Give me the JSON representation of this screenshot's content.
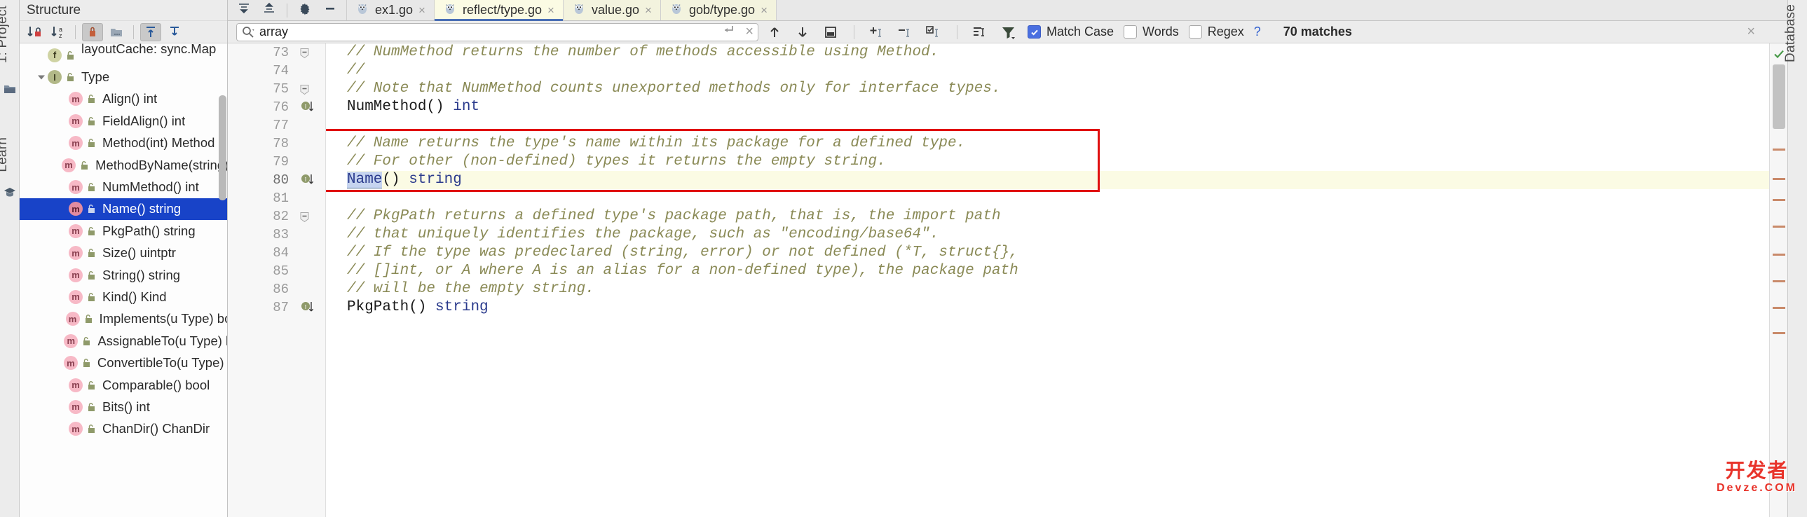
{
  "window": {
    "left_strip": {
      "project_label": "1: Project",
      "learn_label": "Learn",
      "folder_icon": "folder-icon",
      "learn_icon": "graduation-cap-icon"
    },
    "right_strip": {
      "database_label": "Database"
    }
  },
  "sidebar": {
    "title": "Structure",
    "header_actions": [
      {
        "name": "collapse-all-icon",
        "label": "Collapse All"
      },
      {
        "name": "expand-all-icon",
        "label": "Expand All"
      },
      {
        "name": "settings-gear-icon",
        "label": "Settings"
      },
      {
        "name": "hide-icon",
        "label": "Hide"
      }
    ],
    "toolbar": [
      {
        "name": "sort-by-visibility-icon",
        "label": "Sort by Visibility",
        "active": false
      },
      {
        "name": "sort-alphabetically-icon",
        "label": "Sort Alphabetically",
        "active": false
      },
      {
        "name": "show-anonymous-classes-icon",
        "label": "Show Anonymous Classes",
        "active": true
      },
      {
        "name": "group-by-file-icon",
        "label": "Group Methods by Defining Type",
        "active": false
      },
      {
        "name": "expand-all-tree-icon",
        "label": "Expand All",
        "active": true
      },
      {
        "name": "collapse-all-tree-icon",
        "label": "Collapse All",
        "active": false
      }
    ],
    "items": [
      {
        "label": "layoutCache: sync.Map",
        "kind": "field",
        "badge": "f",
        "indent": 1,
        "selected": false,
        "clipped": true,
        "arrow": "none"
      },
      {
        "label": "Type",
        "kind": "interface",
        "badge": "i",
        "indent": 1,
        "selected": false,
        "arrow": "expanded"
      },
      {
        "label": "Align() int",
        "kind": "method",
        "badge": "m",
        "indent": 2,
        "selected": false,
        "arrow": "none"
      },
      {
        "label": "FieldAlign() int",
        "kind": "method",
        "badge": "m",
        "indent": 2,
        "selected": false,
        "arrow": "none"
      },
      {
        "label": "Method(int) Method",
        "kind": "method",
        "badge": "m",
        "indent": 2,
        "selected": false,
        "arrow": "none"
      },
      {
        "label": "MethodByName(string) (Meth",
        "kind": "method",
        "badge": "m",
        "indent": 2,
        "selected": false,
        "arrow": "none"
      },
      {
        "label": "NumMethod() int",
        "kind": "method",
        "badge": "m",
        "indent": 2,
        "selected": false,
        "arrow": "none"
      },
      {
        "label": "Name() string",
        "kind": "method",
        "badge": "m",
        "indent": 2,
        "selected": true,
        "arrow": "none"
      },
      {
        "label": "PkgPath() string",
        "kind": "method",
        "badge": "m",
        "indent": 2,
        "selected": false,
        "arrow": "none"
      },
      {
        "label": "Size() uintptr",
        "kind": "method",
        "badge": "m",
        "indent": 2,
        "selected": false,
        "arrow": "none"
      },
      {
        "label": "String() string",
        "kind": "method",
        "badge": "m",
        "indent": 2,
        "selected": false,
        "arrow": "none"
      },
      {
        "label": "Kind() Kind",
        "kind": "method",
        "badge": "m",
        "indent": 2,
        "selected": false,
        "arrow": "none"
      },
      {
        "label": "Implements(u Type) bool",
        "kind": "method",
        "badge": "m",
        "indent": 2,
        "selected": false,
        "arrow": "none"
      },
      {
        "label": "AssignableTo(u Type) bool",
        "kind": "method",
        "badge": "m",
        "indent": 2,
        "selected": false,
        "arrow": "none"
      },
      {
        "label": "ConvertibleTo(u Type) bool",
        "kind": "method",
        "badge": "m",
        "indent": 2,
        "selected": false,
        "arrow": "none"
      },
      {
        "label": "Comparable() bool",
        "kind": "method",
        "badge": "m",
        "indent": 2,
        "selected": false,
        "arrow": "none"
      },
      {
        "label": "Bits() int",
        "kind": "method",
        "badge": "m",
        "indent": 2,
        "selected": false,
        "arrow": "none"
      },
      {
        "label": "ChanDir() ChanDir",
        "kind": "method",
        "badge": "m",
        "indent": 2,
        "selected": false,
        "arrow": "none"
      }
    ]
  },
  "tabs": [
    {
      "label": "ex1.go",
      "active": false,
      "icon": "go-gopher-icon",
      "close": "×"
    },
    {
      "label": "reflect/type.go",
      "active": true,
      "icon": "go-gopher-icon",
      "close": "×"
    },
    {
      "label": "value.go",
      "active": false,
      "icon": "go-gopher-icon",
      "close": "×"
    },
    {
      "label": "gob/type.go",
      "active": false,
      "icon": "go-gopher-icon",
      "close": "×"
    }
  ],
  "findbar": {
    "search_icon": "search-icon",
    "search_value": "array",
    "search_placeholder": "Search",
    "history_icon": "search-history-dropdown-icon",
    "new_line_icon": "new-line-icon",
    "clear_icon": "clear-search-icon",
    "buttons": [
      {
        "name": "find-previous-icon",
        "label": "Previous Occurrence"
      },
      {
        "name": "find-next-icon",
        "label": "Next Occurrence"
      },
      {
        "name": "select-all-occurrences-icon",
        "label": "Select All Occurrences"
      },
      {
        "name": "add-selection-icon",
        "label": "Add Selection for Next Occurrence"
      },
      {
        "name": "remove-selection-icon",
        "label": "Remove Selection"
      },
      {
        "name": "select-all-icon",
        "label": "Select All"
      },
      {
        "name": "filter-lines-icon",
        "label": "Filter"
      },
      {
        "name": "filter-funnel-icon",
        "label": "Filter Options"
      }
    ],
    "match_case": {
      "label": "Match Case",
      "checked": true
    },
    "words": {
      "label": "Words",
      "checked": false
    },
    "regex": {
      "label": "Regex",
      "checked": false
    },
    "help": "?",
    "matches": "70 matches",
    "close": "×"
  },
  "editor": {
    "first_line": 73,
    "highlight_line": 80,
    "lines": [
      {
        "no": 73,
        "fold": "collapse",
        "mark": "",
        "segments": [
          {
            "t": "// NumMethod returns the number of methods accessible using Method.",
            "c": "cmt"
          }
        ]
      },
      {
        "no": 74,
        "fold": "",
        "mark": "",
        "segments": [
          {
            "t": "//",
            "c": "cmt"
          }
        ]
      },
      {
        "no": 75,
        "fold": "collapse",
        "mark": "",
        "segments": [
          {
            "t": "// Note that NumMethod counts unexported methods only for interface types.",
            "c": "cmt"
          }
        ]
      },
      {
        "no": 76,
        "fold": "",
        "mark": "implement",
        "segments": [
          {
            "t": "NumMethod()",
            "c": "id"
          },
          {
            "t": " ",
            "c": "id"
          },
          {
            "t": "int",
            "c": "kw"
          }
        ]
      },
      {
        "no": 77,
        "fold": "",
        "mark": "",
        "segments": [
          {
            "t": "",
            "c": "id"
          }
        ]
      },
      {
        "no": 78,
        "fold": "",
        "mark": "",
        "segments": [
          {
            "t": "// Name returns the type's name within its package for a defined type.",
            "c": "cmt"
          }
        ]
      },
      {
        "no": 79,
        "fold": "",
        "mark": "",
        "segments": [
          {
            "t": "// For other (non-defined) types it returns the empty string.",
            "c": "cmt"
          }
        ]
      },
      {
        "no": 80,
        "fold": "",
        "mark": "implement",
        "segments": [
          {
            "t": "Name",
            "c": "match"
          },
          {
            "t": "()",
            "c": "id"
          },
          {
            "t": " ",
            "c": "id"
          },
          {
            "t": "string",
            "c": "kw"
          }
        ]
      },
      {
        "no": 81,
        "fold": "",
        "mark": "",
        "segments": [
          {
            "t": "",
            "c": "id"
          }
        ]
      },
      {
        "no": 82,
        "fold": "collapse",
        "mark": "",
        "segments": [
          {
            "t": "// PkgPath returns a defined type's package path, that is, the import path",
            "c": "cmt"
          }
        ]
      },
      {
        "no": 83,
        "fold": "",
        "mark": "",
        "segments": [
          {
            "t": "// that uniquely identifies the package, such as \"encoding/base64\".",
            "c": "cmt"
          }
        ]
      },
      {
        "no": 84,
        "fold": "",
        "mark": "",
        "segments": [
          {
            "t": "// If the type was predeclared (string, error) or not defined (*T, struct{},",
            "c": "cmt"
          }
        ]
      },
      {
        "no": 85,
        "fold": "",
        "mark": "",
        "segments": [
          {
            "t": "// []int, or A where A is an alias for a non-defined type), the package path",
            "c": "cmt"
          }
        ]
      },
      {
        "no": 86,
        "fold": "",
        "mark": "",
        "segments": [
          {
            "t": "// will be the empty string.",
            "c": "cmt"
          }
        ]
      },
      {
        "no": 87,
        "fold": "",
        "mark": "implement",
        "segments": [
          {
            "t": "PkgPath()",
            "c": "id"
          },
          {
            "t": " ",
            "c": "id"
          },
          {
            "t": "string",
            "c": "kw"
          }
        ]
      }
    ]
  },
  "watermark": {
    "line1": "开发者",
    "line2": "Devze.COM"
  },
  "colors": {
    "selection_blue": "#1843c8",
    "accent_red": "#e01010",
    "tab_active": "#fbfbe4",
    "comment_green": "#8a8a56",
    "keyword_blue": "#2a3a8c",
    "checkbox_blue": "#4a6fe0"
  }
}
